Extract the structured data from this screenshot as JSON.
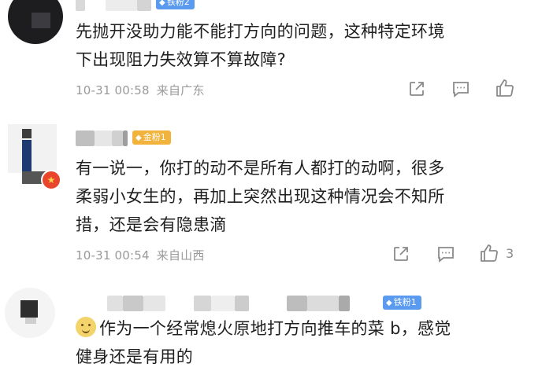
{
  "comments": [
    {
      "badge": "铁粉2",
      "badge_color": "#5a9bf0",
      "text": "先抛开没助力能不能打方向的问题，这种特定环境\n下出现阻力失效算不算故障?",
      "time": "10-31 00:58",
      "location": "来自广东",
      "like_count": ""
    },
    {
      "badge": "金粉1",
      "badge_color": "#f1b33c",
      "text": "有一说一，你打的动不是所有人都打的动啊，很多\n柔弱小女生的，再加上突然出现这种情况会不知所\n措，还是会有隐患滴",
      "time": "10-31 00:54",
      "location": "来自山西",
      "like_count": "3"
    },
    {
      "badge": "铁粉1",
      "badge_color": "#5a9bf0",
      "text": "作为一个经常熄火原地打方向推车的菜 b，感觉\n健身还是有用的",
      "time": "",
      "location": "",
      "like_count": ""
    }
  ],
  "icons": {
    "share": "share-icon",
    "reply": "comment-icon",
    "like": "thumbs-up-icon",
    "emoji": "smiling-face-emoji-icon"
  }
}
